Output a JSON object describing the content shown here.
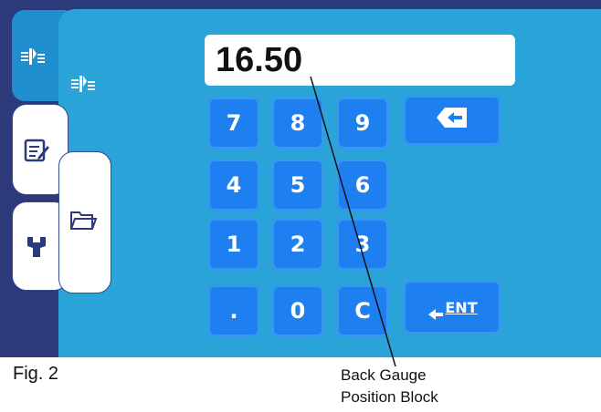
{
  "display": {
    "value": "16.50"
  },
  "keypad": {
    "rows": [
      [
        {
          "label": "7"
        },
        {
          "label": "8"
        },
        {
          "label": "9"
        }
      ],
      [
        {
          "label": "4"
        },
        {
          "label": "5"
        },
        {
          "label": "6"
        }
      ],
      [
        {
          "label": "1"
        },
        {
          "label": "2"
        },
        {
          "label": "3"
        }
      ],
      [
        {
          "label": "."
        },
        {
          "label": "0"
        },
        {
          "label": "C"
        }
      ]
    ],
    "enter_label": "ENT"
  },
  "figure": {
    "label": "Fig. 2"
  },
  "callout": {
    "line1": "Back Gauge",
    "line2": "Position Block"
  },
  "colors": {
    "panel": "#2aa3d9",
    "key": "#1e7ff0",
    "frame": "#2c3a7c",
    "tab_active": "#1f8fcf"
  },
  "icons": {
    "left_tab1": "gauge-position-icon",
    "left_tab2": "edit-document-icon",
    "left_tab3": "wrench-icon",
    "mid_tab": "folder-icon",
    "panel_header": "gauge-position-icon",
    "backspace": "backspace-icon",
    "enter": "enter-icon"
  }
}
